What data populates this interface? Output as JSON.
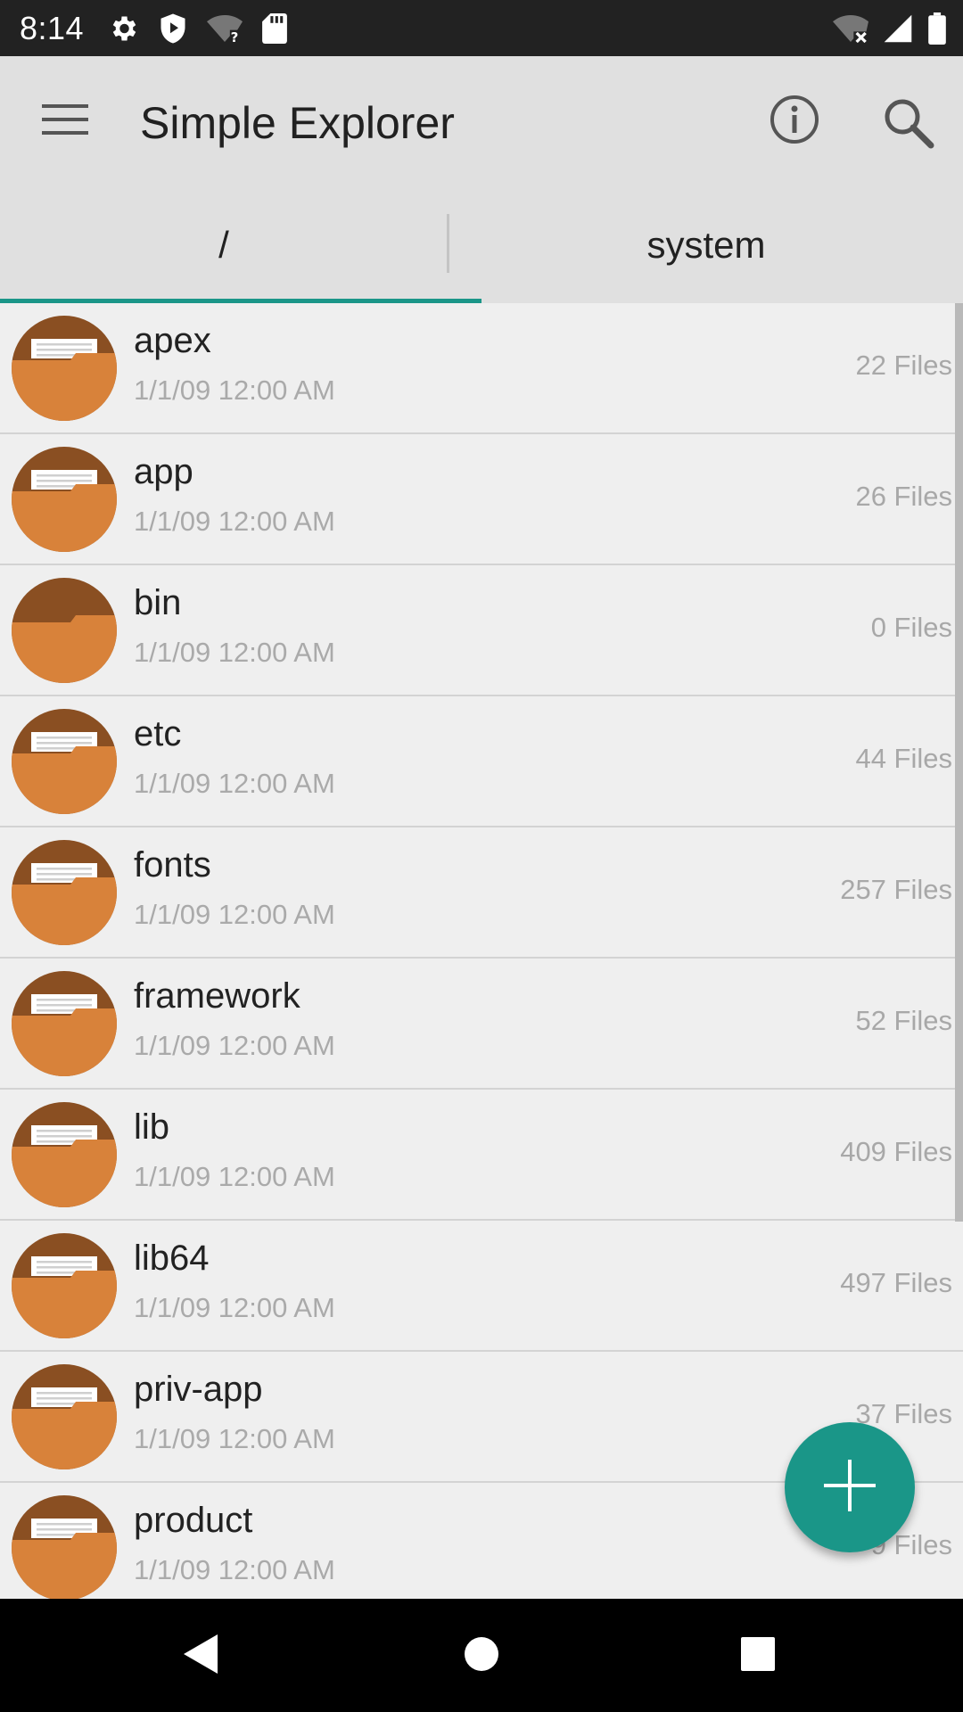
{
  "status_bar": {
    "time": "8:14"
  },
  "app_bar": {
    "title": "Simple Explorer"
  },
  "tabs": [
    {
      "label": "/",
      "selected": true
    },
    {
      "label": "system",
      "selected": false
    }
  ],
  "files": [
    {
      "name": "apex",
      "date": "1/1/09 12:00 AM",
      "count": "22 Files",
      "has_contents": true
    },
    {
      "name": "app",
      "date": "1/1/09 12:00 AM",
      "count": "26 Files",
      "has_contents": true
    },
    {
      "name": "bin",
      "date": "1/1/09 12:00 AM",
      "count": "0 Files",
      "has_contents": false
    },
    {
      "name": "etc",
      "date": "1/1/09 12:00 AM",
      "count": "44 Files",
      "has_contents": true
    },
    {
      "name": "fonts",
      "date": "1/1/09 12:00 AM",
      "count": "257 Files",
      "has_contents": true
    },
    {
      "name": "framework",
      "date": "1/1/09 12:00 AM",
      "count": "52 Files",
      "has_contents": true
    },
    {
      "name": "lib",
      "date": "1/1/09 12:00 AM",
      "count": "409 Files",
      "has_contents": true
    },
    {
      "name": "lib64",
      "date": "1/1/09 12:00 AM",
      "count": "497 Files",
      "has_contents": true
    },
    {
      "name": "priv-app",
      "date": "1/1/09 12:00 AM",
      "count": "37 Files",
      "has_contents": true
    },
    {
      "name": "product",
      "date": "1/1/09 12:00 AM",
      "count": "9 Files",
      "has_contents": true
    }
  ],
  "icons": {
    "menu": "hamburger-menu-icon",
    "info": "info-icon",
    "search": "search-icon",
    "fab": "plus-icon",
    "folder": "folder-icon"
  },
  "colors": {
    "accent": "#1a9688",
    "folder_front": "#d8823a",
    "folder_back": "#8a4f22",
    "app_bar": "#e0e0e0"
  }
}
